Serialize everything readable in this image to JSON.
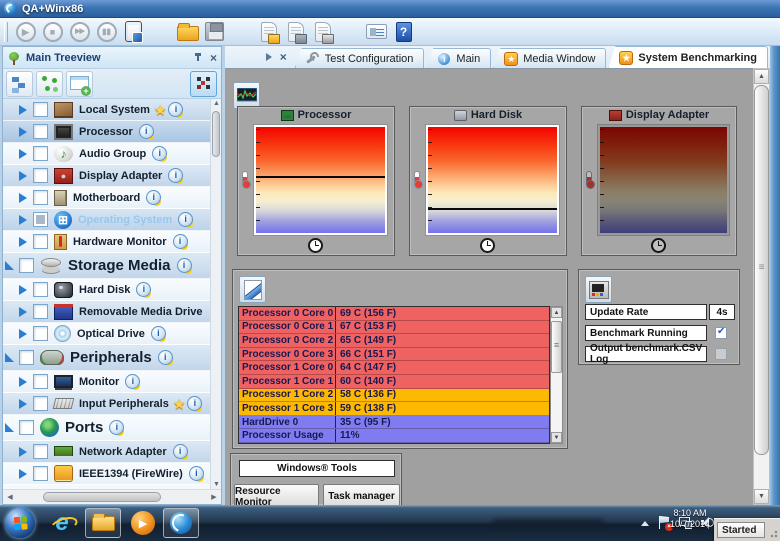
{
  "window": {
    "title": "QA+Winx86",
    "status": "Started"
  },
  "toolbar": {
    "buttons": [
      {
        "name": "play",
        "glyph": "▶",
        "cls": "circle"
      },
      {
        "name": "stop",
        "glyph": "■",
        "cls": "circle"
      },
      {
        "name": "fast-forward",
        "glyph": "▶▶",
        "cls": "circle"
      },
      {
        "name": "pause",
        "glyph": "▮▮",
        "cls": "circle"
      },
      {
        "name": "test-setup",
        "cls": "clipboard"
      },
      {
        "name": "sep",
        "cls": "is-sep"
      },
      {
        "name": "open-folder",
        "cls": "folder"
      },
      {
        "name": "save",
        "cls": "floppy"
      },
      {
        "name": "sep",
        "cls": "is-sep"
      },
      {
        "name": "script-open",
        "cls": "script"
      },
      {
        "name": "script-save",
        "cls": "script"
      },
      {
        "name": "script-print",
        "cls": "script"
      },
      {
        "name": "sep",
        "cls": "is-sep"
      },
      {
        "name": "options",
        "cls": "options"
      },
      {
        "name": "help",
        "glyph": "?",
        "cls": "help"
      }
    ]
  },
  "sidebar": {
    "title": "Main Treeview",
    "toolbar": [
      {
        "name": "org-chart-view"
      },
      {
        "name": "node-graph-view"
      },
      {
        "name": "new-window"
      },
      {
        "name": "overview-map",
        "cls": "active"
      }
    ],
    "tree": [
      {
        "label": "Local System",
        "icon": "local-system",
        "badges": "star info",
        "cls": "alt",
        "arrow": "col"
      },
      {
        "label": "Processor",
        "icon": "processor",
        "badges": "info",
        "cls": "sel",
        "arrow": "col"
      },
      {
        "label": "Audio Group",
        "icon": "audio-group",
        "badges": "info",
        "cls": "light",
        "arrow": "col"
      },
      {
        "label": "Display Adapter",
        "icon": "display-adapter",
        "badges": "info",
        "cls": "alt",
        "arrow": "col"
      },
      {
        "label": "Motherboard",
        "icon": "motherboard",
        "badges": "info",
        "cls": "light",
        "arrow": "col"
      },
      {
        "label": "Operating System",
        "icon": "operating-system",
        "badges": "info",
        "cls": "os",
        "check": "mixed",
        "arrow": "col"
      },
      {
        "label": "Hardware Monitor",
        "icon": "hardware-monitor",
        "badges": "info",
        "cls": "light",
        "arrow": "col"
      },
      {
        "label": "Storage Media",
        "icon": "storage-media",
        "badges": "info",
        "cls": "group alt",
        "arrow": "exp"
      },
      {
        "label": "Hard Disk",
        "icon": "hard-disk",
        "badges": "info",
        "cls": "light",
        "arrow": "col"
      },
      {
        "label": "Removable Media Drive",
        "icon": "removable-media-drive",
        "badges": "",
        "cls": "alt",
        "arrow": "col"
      },
      {
        "label": "Optical Drive",
        "icon": "optical-drive",
        "badges": "info",
        "cls": "light",
        "arrow": "col"
      },
      {
        "label": "Peripherals",
        "icon": "peripherals",
        "badges": "info",
        "cls": "group alt",
        "arrow": "exp"
      },
      {
        "label": "Monitor",
        "icon": "monitor",
        "badges": "info",
        "cls": "light",
        "arrow": "col"
      },
      {
        "label": "Input Peripherals",
        "icon": "input-peripherals",
        "badges": "star info",
        "cls": "alt",
        "arrow": "col"
      },
      {
        "label": "Ports",
        "icon": "ports",
        "badges": "info",
        "cls": "group light",
        "arrow": "exp"
      },
      {
        "label": "Network Adapter",
        "icon": "network-adapter",
        "badges": "info",
        "cls": "alt",
        "arrow": "col"
      },
      {
        "label": "IEEE1394 (FireWire)",
        "icon": "ieee1394-firewire",
        "badges": "info",
        "cls": "light",
        "arrow": "col"
      }
    ]
  },
  "tabs": [
    {
      "label": "Test Configuration",
      "icon": "wrench"
    },
    {
      "label": "Main",
      "icon": "info"
    },
    {
      "label": "Media Window",
      "icon": "star"
    },
    {
      "label": "System Benchmarking",
      "icon": "star",
      "cls": "active"
    }
  ],
  "gauges": [
    {
      "title": "Processor",
      "icon": "processor",
      "style_vars": {
        "line": "46%"
      }
    },
    {
      "title": "Hard Disk",
      "icon": "hard-disk",
      "style_vars": {
        "line": "76%"
      }
    },
    {
      "title": "Display Adapter",
      "icon": "display-adapter",
      "cls": "dim"
    }
  ],
  "readouts": {
    "rows": [
      {
        "label": "Processor 0 Core 0",
        "value": "69 C (156 F)",
        "color": "#ef6262",
        "style_vars": {
          "row-bg": "#ef6262"
        }
      },
      {
        "label": "Processor 0 Core 1",
        "value": "67 C (153 F)",
        "color": "#ef6262",
        "style_vars": {
          "row-bg": "#ef6262"
        }
      },
      {
        "label": "Processor 0 Core 2",
        "value": "65 C (149 F)",
        "color": "#ef6262",
        "style_vars": {
          "row-bg": "#ef6262"
        }
      },
      {
        "label": "Processor 0 Core 3",
        "value": "66 C (151 F)",
        "color": "#ef6262",
        "style_vars": {
          "row-bg": "#ef6262"
        }
      },
      {
        "label": "Processor 1 Core 0",
        "value": "64 C (147 F)",
        "color": "#ef6262",
        "style_vars": {
          "row-bg": "#ef6262"
        }
      },
      {
        "label": "Processor 1 Core 1",
        "value": "60 C (140 F)",
        "color": "#ef6262",
        "style_vars": {
          "row-bg": "#ef6262"
        }
      },
      {
        "label": "Processor 1 Core 2",
        "value": "58 C (136 F)",
        "color": "#fdb802",
        "style_vars": {
          "row-bg": "#fdb802"
        }
      },
      {
        "label": "Processor 1 Core 3",
        "value": "59 C (138 F)",
        "color": "#fdb802",
        "style_vars": {
          "row-bg": "#fdb802"
        }
      },
      {
        "label": "HardDrive 0",
        "value": "35 C (95 F)",
        "color": "#7e7cf0",
        "style_vars": {
          "row-bg": "#7e7cf0"
        }
      },
      {
        "label": "Processor Usage",
        "value": "11%",
        "color": "#7e7cf0",
        "style_vars": {
          "row-bg": "#7e7cf0"
        }
      }
    ]
  },
  "settings": {
    "update_rate_label": "Update Rate",
    "update_rate_value": "4s",
    "benchmark_label": "Benchmark Running",
    "benchmark_checked": true,
    "csv_label": "Output benchmark.CSV Log",
    "csv_checked": false
  },
  "tools": {
    "header": "Windows® Tools",
    "buttons": [
      "Resource Monitor",
      "Task manager"
    ]
  },
  "taskbar": {
    "time": "8:10 AM",
    "date": "10/7/2014"
  },
  "theme": {
    "accent": "#2a7fd4",
    "hot": "#f20400",
    "warm": "#fde8b8",
    "cool": "#7272ec"
  }
}
